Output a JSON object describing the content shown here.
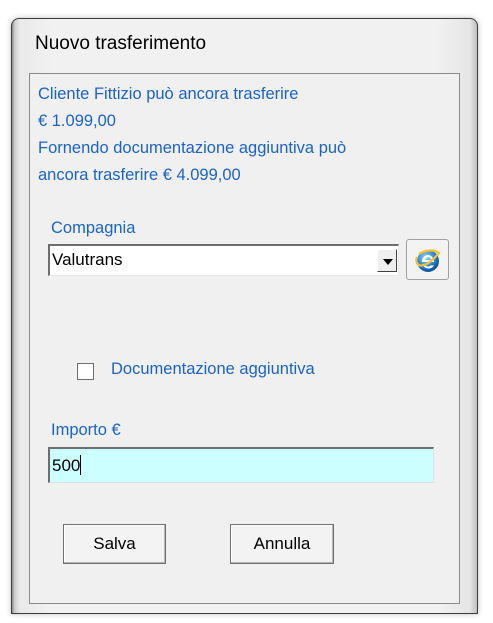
{
  "window": {
    "title": "Nuovo trasferimento"
  },
  "info": {
    "line1": "Cliente Fittizio può ancora trasferire",
    "line2": "€ 1.099,00",
    "line3": "Fornendo documentazione aggiuntiva può",
    "line4": "ancora trasferire € 4.099,00"
  },
  "company": {
    "label": "Compagnia",
    "selected": "Valutrans",
    "web_icon": "internet-explorer-icon"
  },
  "extra_docs": {
    "label": "Documentazione aggiuntiva",
    "checked": false
  },
  "amount": {
    "label": "Importo €",
    "value": "500"
  },
  "buttons": {
    "save": "Salva",
    "cancel": "Annulla"
  },
  "colors": {
    "label_blue": "#1b63c8",
    "input_bg": "#ccffff",
    "dialog_bg": "#f0f0f0"
  }
}
